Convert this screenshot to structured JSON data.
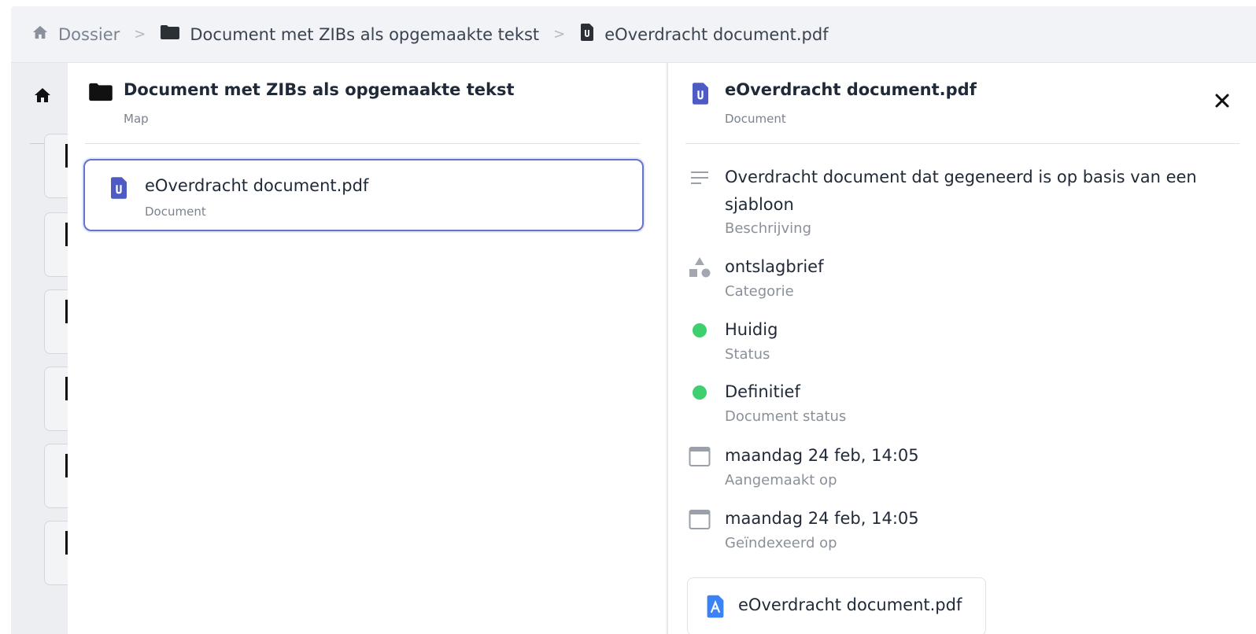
{
  "breadcrumb": {
    "home_label": "Dossier",
    "folder_label": "Document met ZIBs als opgemaakte tekst",
    "file_label": "eOverdracht document.pdf",
    "separator": ">"
  },
  "folder_panel": {
    "title": "Document met ZIBs als opgemaakte tekst",
    "subtitle": "Map",
    "items": [
      {
        "title": "eOverdracht document.pdf",
        "subtitle": "Document"
      }
    ]
  },
  "detail_panel": {
    "title": "eOverdracht document.pdf",
    "subtitle": "Document",
    "close_icon": "close-icon",
    "properties": [
      {
        "value": "Overdracht document dat gegeneerd is op basis van een sjabloon",
        "label": "Beschrijving",
        "icon": "text-lines-icon"
      },
      {
        "value": "ontslagbrief",
        "label": "Categorie",
        "icon": "shapes-icon"
      },
      {
        "value": "Huidig",
        "label": "Status",
        "icon": "green-dot-icon"
      },
      {
        "value": "Definitief",
        "label": "Document status",
        "icon": "green-dot-icon"
      },
      {
        "value": "maandag 24 feb, 14:05",
        "label": "Aangemaakt op",
        "icon": "calendar-icon"
      },
      {
        "value": "maandag 24 feb, 14:05",
        "label": "Geïndexeerd op",
        "icon": "calendar-icon"
      }
    ],
    "file_chip": "eOverdracht document.pdf"
  },
  "colors": {
    "accent": "#4f5bc4",
    "status_green": "#3ecf6e",
    "pdf_blue": "#3b82f6"
  }
}
